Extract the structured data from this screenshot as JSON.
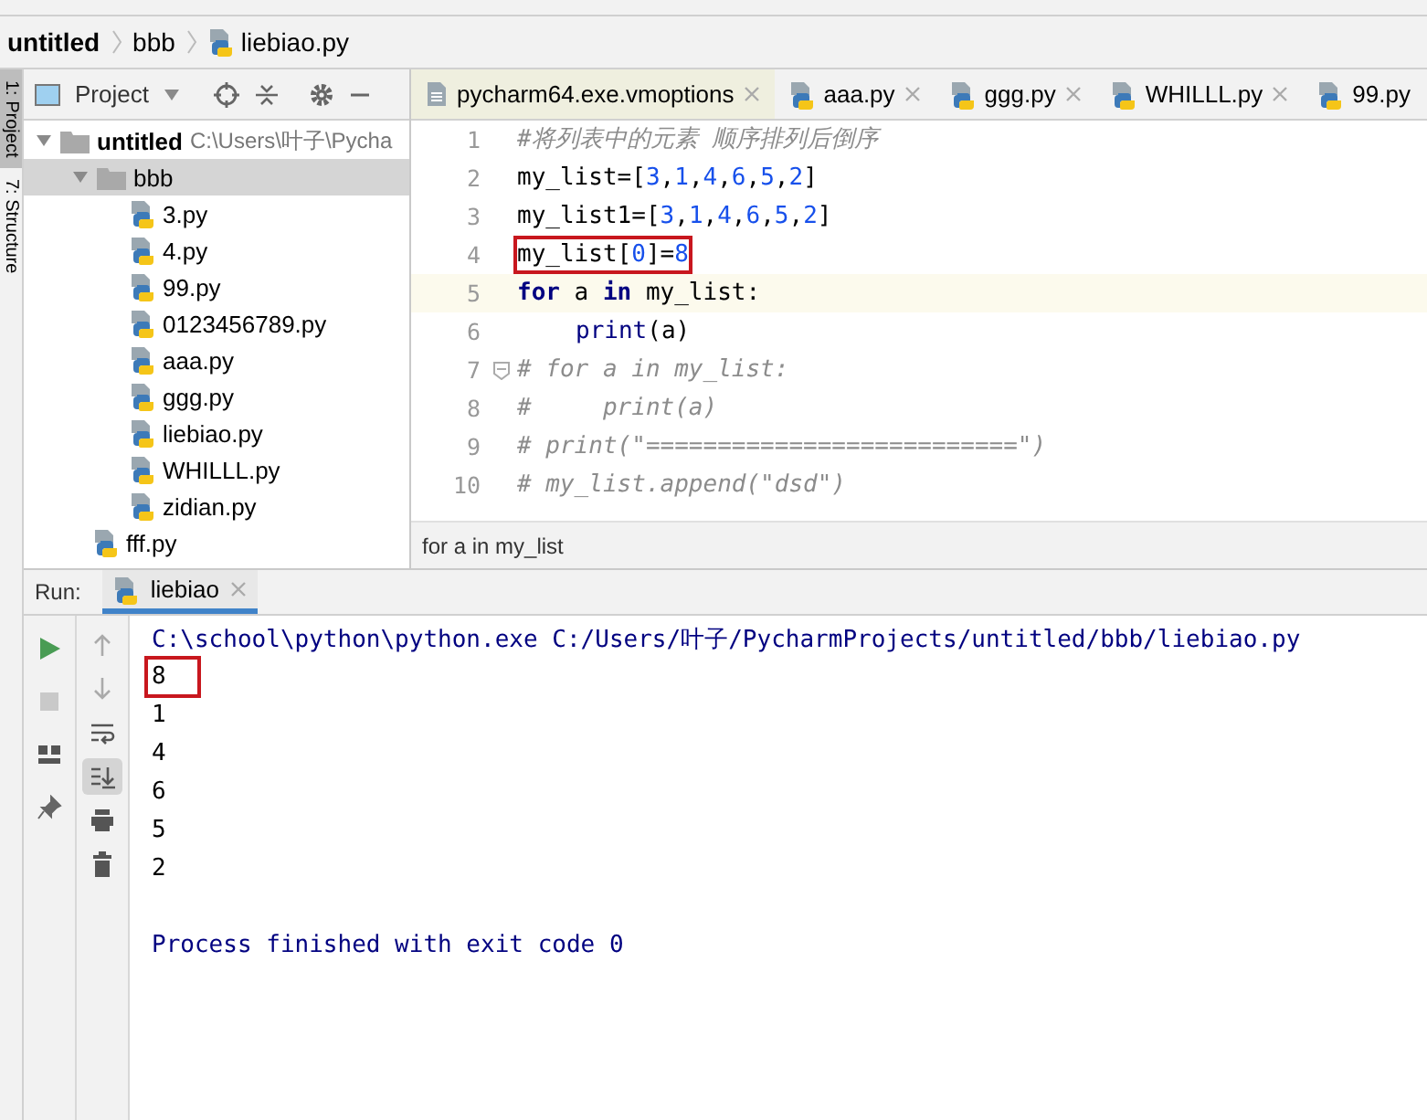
{
  "breadcrumb": [
    {
      "label": "untitled",
      "kind": "project"
    },
    {
      "label": "bbb",
      "kind": "folder"
    },
    {
      "label": "liebiao.py",
      "kind": "file"
    }
  ],
  "side_tabs": [
    {
      "label": "1: Project",
      "selected": true
    },
    {
      "label": "7: Structure",
      "selected": false
    }
  ],
  "project_panel": {
    "title": "Project",
    "tree": [
      {
        "label": "untitled",
        "path": "C:\\Users\\叶子\\Pycha",
        "kind": "folder",
        "expanded": true,
        "selected": false,
        "children": [
          {
            "label": "bbb",
            "kind": "folder",
            "expanded": true,
            "selected": true,
            "children": [
              {
                "label": "3.py",
                "kind": "file",
                "selected": false
              },
              {
                "label": "4.py",
                "kind": "file",
                "selected": false
              },
              {
                "label": "99.py",
                "kind": "file",
                "selected": false
              },
              {
                "label": "0123456789.py",
                "kind": "file",
                "selected": false
              },
              {
                "label": "aaa.py",
                "kind": "file",
                "selected": false
              },
              {
                "label": "ggg.py",
                "kind": "file",
                "selected": false
              },
              {
                "label": "liebiao.py",
                "kind": "file",
                "selected": false
              },
              {
                "label": "WHILLL.py",
                "kind": "file",
                "selected": false
              },
              {
                "label": "zidian.py",
                "kind": "file",
                "selected": false
              }
            ]
          },
          {
            "label": "fff.py",
            "kind": "file",
            "selected": false
          }
        ]
      }
    ]
  },
  "editor": {
    "tabs": [
      {
        "label": "pycharm64.exe.vmoptions",
        "kind": "text",
        "selected": true,
        "closable": true
      },
      {
        "label": "aaa.py",
        "kind": "python",
        "selected": false,
        "closable": true
      },
      {
        "label": "ggg.py",
        "kind": "python",
        "selected": false,
        "closable": true
      },
      {
        "label": "WHILLL.py",
        "kind": "python",
        "selected": false,
        "closable": true
      },
      {
        "label": "99.py",
        "kind": "python",
        "selected": false,
        "closable": false
      }
    ],
    "lines": [
      {
        "number": "1",
        "current": false,
        "boxed": false,
        "fold": false,
        "tokens": [
          {
            "text": "#将列表中的元素 顺序排列后倒序",
            "kind": "comment"
          }
        ]
      },
      {
        "number": "2",
        "current": false,
        "boxed": false,
        "fold": false,
        "tokens": [
          {
            "text": "my_list=[",
            "kind": "plain"
          },
          {
            "text": "3",
            "kind": "number"
          },
          {
            "text": ",",
            "kind": "plain"
          },
          {
            "text": "1",
            "kind": "number"
          },
          {
            "text": ",",
            "kind": "plain"
          },
          {
            "text": "4",
            "kind": "number"
          },
          {
            "text": ",",
            "kind": "plain"
          },
          {
            "text": "6",
            "kind": "number"
          },
          {
            "text": ",",
            "kind": "plain"
          },
          {
            "text": "5",
            "kind": "number"
          },
          {
            "text": ",",
            "kind": "plain"
          },
          {
            "text": "2",
            "kind": "number"
          },
          {
            "text": "]",
            "kind": "plain"
          }
        ]
      },
      {
        "number": "3",
        "current": false,
        "boxed": false,
        "fold": false,
        "tokens": [
          {
            "text": "my_list1=[",
            "kind": "plain"
          },
          {
            "text": "3",
            "kind": "number"
          },
          {
            "text": ",",
            "kind": "plain"
          },
          {
            "text": "1",
            "kind": "number"
          },
          {
            "text": ",",
            "kind": "plain"
          },
          {
            "text": "4",
            "kind": "number"
          },
          {
            "text": ",",
            "kind": "plain"
          },
          {
            "text": "6",
            "kind": "number"
          },
          {
            "text": ",",
            "kind": "plain"
          },
          {
            "text": "5",
            "kind": "number"
          },
          {
            "text": ",",
            "kind": "plain"
          },
          {
            "text": "2",
            "kind": "number"
          },
          {
            "text": "]",
            "kind": "plain"
          }
        ]
      },
      {
        "number": "4",
        "current": false,
        "boxed": true,
        "fold": false,
        "tokens": [
          {
            "text": "my_list[",
            "kind": "plain"
          },
          {
            "text": "0",
            "kind": "number"
          },
          {
            "text": "]=",
            "kind": "plain"
          },
          {
            "text": "8",
            "kind": "number"
          }
        ]
      },
      {
        "number": "5",
        "current": true,
        "boxed": false,
        "fold": false,
        "tokens": [
          {
            "text": "for",
            "kind": "keyword"
          },
          {
            "text": " a ",
            "kind": "plain"
          },
          {
            "text": "in",
            "kind": "keyword"
          },
          {
            "text": " my_list:",
            "kind": "plain"
          }
        ]
      },
      {
        "number": "6",
        "current": false,
        "boxed": false,
        "fold": false,
        "indented": true,
        "tokens": [
          {
            "text": "print",
            "kind": "builtin"
          },
          {
            "text": "(a)",
            "kind": "plain"
          }
        ]
      },
      {
        "number": "7",
        "current": false,
        "boxed": false,
        "fold": true,
        "tokens": [
          {
            "text": "# for a in my_list:",
            "kind": "comment"
          }
        ]
      },
      {
        "number": "8",
        "current": false,
        "boxed": false,
        "fold": false,
        "tokens": [
          {
            "text": "#     print(a)",
            "kind": "comment"
          }
        ]
      },
      {
        "number": "9",
        "current": false,
        "boxed": false,
        "fold": false,
        "tokens": [
          {
            "text": "# print(\"==========================\")",
            "kind": "comment"
          }
        ]
      },
      {
        "number": "10",
        "current": false,
        "boxed": false,
        "fold": false,
        "tokens": [
          {
            "text": "# my_list.append(\"dsd\")",
            "kind": "comment"
          }
        ]
      }
    ],
    "breadcrumb": "for a in my_list"
  },
  "run": {
    "label": "Run:",
    "tab": "liebiao",
    "actions": [
      {
        "kind": "run",
        "enabled": true
      },
      {
        "kind": "stop",
        "enabled": false
      },
      {
        "kind": "layout",
        "enabled": true
      },
      {
        "kind": "pin",
        "enabled": true
      }
    ],
    "tools": [
      {
        "kind": "up",
        "on": false
      },
      {
        "kind": "down",
        "on": false
      },
      {
        "kind": "wrap",
        "on": false
      },
      {
        "kind": "scroll-end",
        "on": true
      },
      {
        "kind": "print",
        "on": false
      },
      {
        "kind": "trash",
        "on": false
      }
    ],
    "lines": [
      {
        "text": "C:\\school\\python\\python.exe C:/Users/叶子/PycharmProjects/untitled/bbb/liebiao.py",
        "kind": "system",
        "boxed": false
      },
      {
        "text": "8",
        "kind": "output",
        "boxed": true
      },
      {
        "text": "1",
        "kind": "output",
        "boxed": false
      },
      {
        "text": "4",
        "kind": "output",
        "boxed": false
      },
      {
        "text": "6",
        "kind": "output",
        "boxed": false
      },
      {
        "text": "5",
        "kind": "output",
        "boxed": false
      },
      {
        "text": "2",
        "kind": "output",
        "boxed": false
      },
      {
        "kind": "blank"
      },
      {
        "text": "Process finished with exit code 0",
        "kind": "system",
        "boxed": false
      }
    ]
  }
}
